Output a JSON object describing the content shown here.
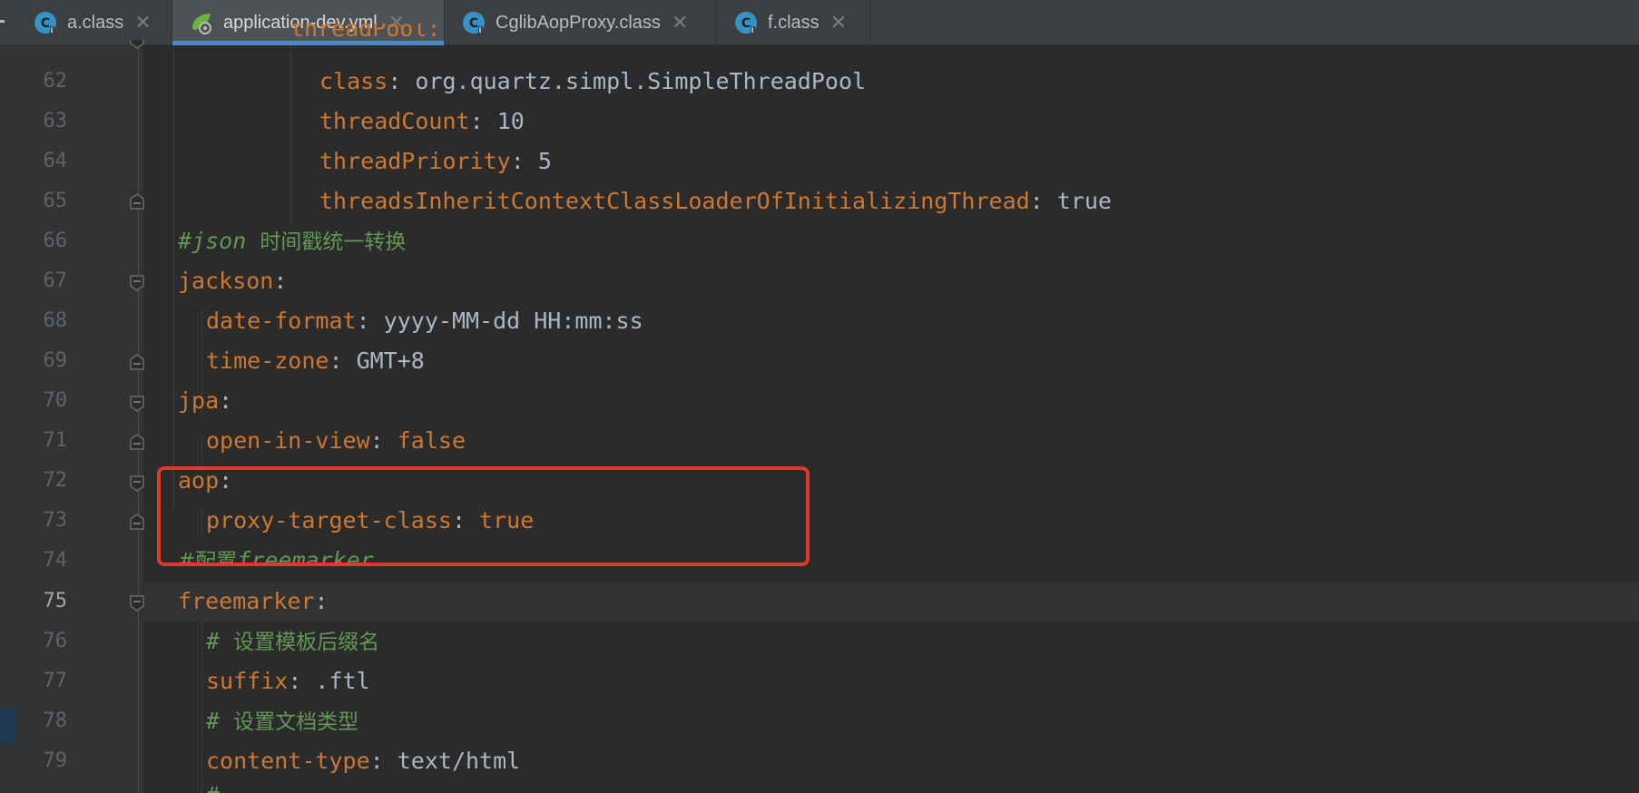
{
  "tabs": [
    {
      "label": "a.class",
      "icon": "class-icon",
      "active": false
    },
    {
      "label": "application-dev.yml",
      "icon": "spring-yml-icon",
      "active": true
    },
    {
      "label": "CglibAopProxy.class",
      "icon": "class-icon",
      "active": false
    },
    {
      "label": "f.class",
      "icon": "class-icon",
      "active": false
    }
  ],
  "editor": {
    "current_line": "75",
    "lines": [
      {
        "num": "62",
        "key": "class",
        "sep": ": ",
        "value": "org.quartz.simpl.SimpleThreadPool"
      },
      {
        "num": "63",
        "key": "threadCount",
        "sep": ": ",
        "value": "10"
      },
      {
        "num": "64",
        "key": "threadPriority",
        "sep": ": ",
        "value": "5"
      },
      {
        "num": "65",
        "key": "threadsInheritContextClassLoaderOfInitializingThread",
        "sep": ": ",
        "value": "true"
      },
      {
        "num": "66",
        "comment_prefix": "#json ",
        "comment_text": "时间戳统一转换"
      },
      {
        "num": "67",
        "key": "jackson",
        "sep": ":",
        "value": ""
      },
      {
        "num": "68",
        "key": "date-format",
        "sep": ": ",
        "value": "yyyy-MM-dd HH:mm:ss"
      },
      {
        "num": "69",
        "key": "time-zone",
        "sep": ": ",
        "value": "GMT+8"
      },
      {
        "num": "70",
        "key": "jpa",
        "sep": ":",
        "value": ""
      },
      {
        "num": "71",
        "key": "open-in-view",
        "sep": ": ",
        "value": "false"
      },
      {
        "num": "72",
        "key": "aop",
        "sep": ":",
        "value": ""
      },
      {
        "num": "73",
        "key": "proxy-target-class",
        "sep": ": ",
        "value": "true"
      },
      {
        "num": "74",
        "comment_prefix": "#配置",
        "comment_text": "freemarker"
      },
      {
        "num": "75",
        "key": "freemarker",
        "sep": ":",
        "value": ""
      },
      {
        "num": "76",
        "comment_prefix": "# ",
        "comment_text": "设置模板后缀名"
      },
      {
        "num": "77",
        "key": "suffix",
        "sep": ": ",
        "value": ".ftl"
      },
      {
        "num": "78",
        "comment_prefix": "# ",
        "comment_text": "设置文档类型"
      },
      {
        "num": "79",
        "key": "content-type",
        "sep": ": ",
        "value": "text/html"
      }
    ]
  },
  "colors": {
    "key": "#cc7832",
    "value": "#a9b7c6",
    "comment": "#629755",
    "highlight_box": "#e0382a",
    "tab_underline": "#4a88c7"
  }
}
